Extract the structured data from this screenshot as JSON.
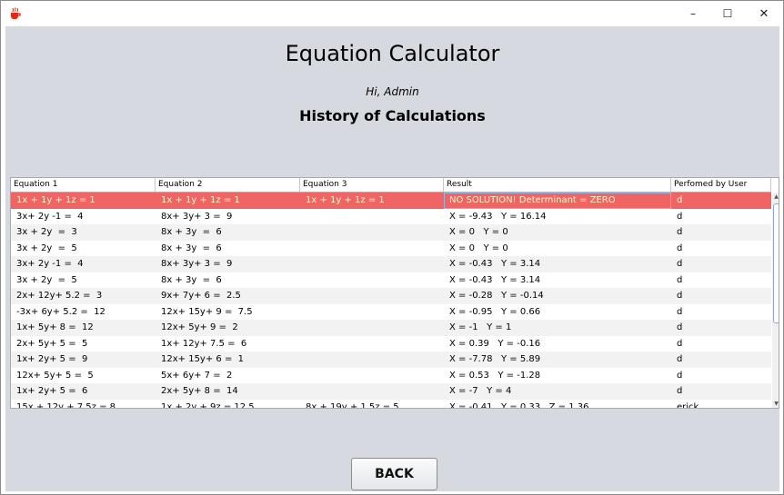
{
  "window": {
    "icon": "java-cup-icon",
    "controls": {
      "minimize": "–",
      "maximize": "☐",
      "close": "✕"
    }
  },
  "header": {
    "title": "Equation Calculator",
    "greeting": "Hi, Admin",
    "subtitle": "History of Calculations"
  },
  "table": {
    "columns": [
      "Equation 1",
      "Equation 2",
      "Equation 3",
      "Result",
      "Perfomed by User"
    ],
    "selected_row": 0,
    "rows": [
      [
        "1x + 1y + 1z = 1",
        "1x + 1y + 1z = 1",
        "1x + 1y + 1z = 1",
        "NO SOLUTION! Determinant = ZERO",
        "d"
      ],
      [
        "3x+ 2y -1 =  4",
        "8x+ 3y+ 3 =  9",
        "",
        "X = -9.43   Y = 16.14",
        "d"
      ],
      [
        "3x + 2y  =  3",
        "8x + 3y  =  6",
        "",
        "X = 0   Y = 0",
        "d"
      ],
      [
        "3x + 2y  =  5",
        "8x + 3y  =  6",
        "",
        "X = 0   Y = 0",
        "d"
      ],
      [
        "3x+ 2y -1 =  4",
        "8x+ 3y+ 3 =  9",
        "",
        "X = -0.43   Y = 3.14",
        "d"
      ],
      [
        "3x + 2y  =  5",
        "8x + 3y  =  6",
        "",
        "X = -0.43   Y = 3.14",
        "d"
      ],
      [
        "2x+ 12y+ 5.2 =  3",
        "9x+ 7y+ 6 =  2.5",
        "",
        "X = -0.28   Y = -0.14",
        "d"
      ],
      [
        "-3x+ 6y+ 5.2 =  12",
        "12x+ 15y+ 9 =  7.5",
        "",
        "X = -0.95   Y = 0.66",
        "d"
      ],
      [
        "1x+ 5y+ 8 =  12",
        "12x+ 5y+ 9 =  2",
        "",
        "X = -1   Y = 1",
        "d"
      ],
      [
        "2x+ 5y+ 5 =  5",
        "1x+ 12y+ 7.5 =  6",
        "",
        "X = 0.39   Y = -0.16",
        "d"
      ],
      [
        "1x+ 2y+ 5 =  9",
        "12x+ 15y+ 6 =  1",
        "",
        "X = -7.78   Y = 5.89",
        "d"
      ],
      [
        "12x+ 5y+ 5 =  5",
        "5x+ 6y+ 7 =  2",
        "",
        "X = 0.53   Y = -1.28",
        "d"
      ],
      [
        "1x+ 2y+ 5 =  6",
        "2x+ 5y+ 8 =  14",
        "",
        "X = -7   Y = 4",
        "d"
      ],
      [
        "15x + 12y + 7.5z = 8",
        "1x + 2y + 9z = 12.5",
        "8x + 19y + 1.5z = 5",
        "X = -0.41   Y = 0.33   Z = 1.36",
        "erick"
      ]
    ]
  },
  "scrollbar": {
    "up": "▲",
    "down": "▼"
  },
  "footer": {
    "back_label": "BACK"
  },
  "colors": {
    "selected_row_bg": "#ef6565",
    "selected_row_text": "#fff8c9",
    "panel_bg": "#d6d9df"
  }
}
